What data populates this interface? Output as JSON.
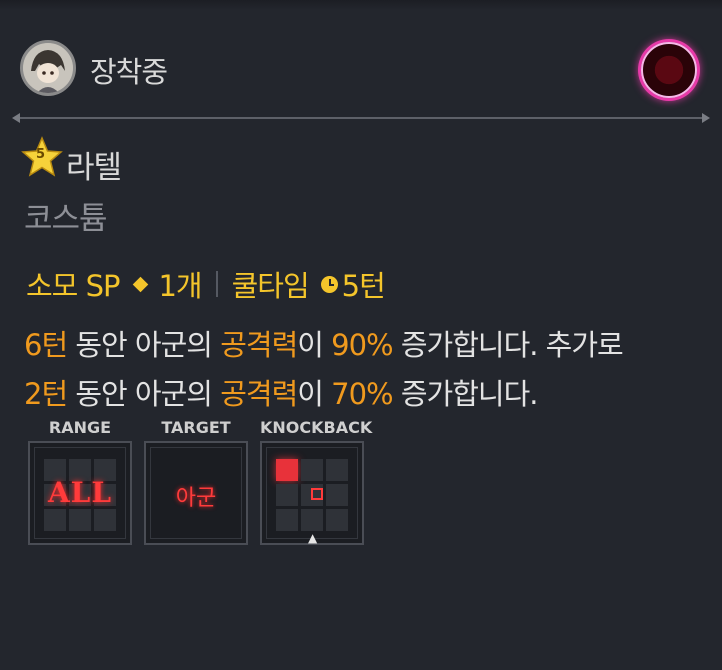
{
  "header": {
    "equip_label": "장착중",
    "avatar_icon": "character-portrait-icon",
    "gem_icon": "red-gem-icon"
  },
  "character": {
    "star_level": "5",
    "name": "라텔",
    "item_type": "코스튬"
  },
  "cost": {
    "sp_label": "소모 SP",
    "sp_value": "1개",
    "cooldown_label": "쿨타임",
    "cooldown_value": "5턴"
  },
  "description": {
    "line1": {
      "a": "6턴",
      "b": " 동안 아군의 ",
      "c": "공격력",
      "d": "이 ",
      "e": "90%",
      "f": " 증가합니다. 추가로"
    },
    "line2": {
      "a": "2턴",
      "b": " 동안 아군의 ",
      "c": "공격력",
      "d": "이 ",
      "e": "70%",
      "f": " 증가합니다."
    }
  },
  "skill_boxes": {
    "range": {
      "label": "RANGE",
      "value": "ALL"
    },
    "target": {
      "label": "TARGET",
      "value": "아군"
    },
    "knockback": {
      "label": "KNOCKBACK"
    }
  },
  "colors": {
    "background": "#23262d",
    "accent_yellow": "#f4c52b",
    "accent_orange": "#f09a1e",
    "accent_red": "#e8323a"
  }
}
